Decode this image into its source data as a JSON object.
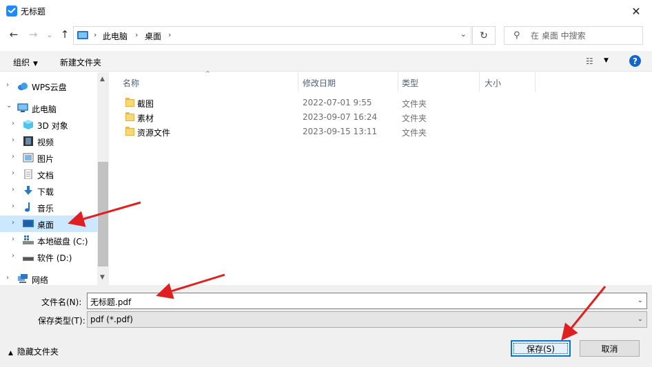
{
  "window": {
    "title": "无标题",
    "close_glyph": "✕"
  },
  "nav": {
    "back_glyph": "←",
    "forward_glyph": "→",
    "recent_glyph": "⌄",
    "up_glyph": "↑",
    "refresh_glyph": "↻",
    "breadcrumb": [
      "此电脑",
      "桌面"
    ],
    "breadcrumb_sep": "›",
    "dropdown_glyph": "⌄",
    "search_placeholder": "在 桌面 中搜索",
    "search_glyph": "⚲"
  },
  "toolbar": {
    "organize": "组织",
    "new_folder": "新建文件夹",
    "caret": "▼",
    "view_glyph": "☷",
    "help": "?"
  },
  "sidebar": {
    "items": [
      {
        "label": "WPS云盘",
        "icon": "cloud-icon"
      },
      {
        "label": "此电脑",
        "icon": "computer-icon",
        "expanded": true
      },
      {
        "label": "3D 对象",
        "icon": "cube-3d-icon"
      },
      {
        "label": "视频",
        "icon": "video-icon"
      },
      {
        "label": "图片",
        "icon": "picture-icon"
      },
      {
        "label": "文档",
        "icon": "document-icon"
      },
      {
        "label": "下载",
        "icon": "download-icon"
      },
      {
        "label": "音乐",
        "icon": "music-icon"
      },
      {
        "label": "桌面",
        "icon": "desktop-icon",
        "selected": true
      },
      {
        "label": "本地磁盘 (C:)",
        "icon": "drive-icon"
      },
      {
        "label": "软件 (D:)",
        "icon": "drive-icon"
      },
      {
        "label": "网络",
        "icon": "network-icon"
      }
    ],
    "chev_right": "›",
    "chev_down": "⌄",
    "scroll_up": "▲",
    "scroll_down": "▼"
  },
  "files": {
    "columns": {
      "name": "名称",
      "modified": "修改日期",
      "type": "类型",
      "size": "大小"
    },
    "sort_caret": "^",
    "rows": [
      {
        "name": "截图",
        "modified": "2022-07-01 9:55",
        "type": "文件夹"
      },
      {
        "name": "素材",
        "modified": "2023-09-07 16:24",
        "type": "文件夹"
      },
      {
        "name": "资源文件",
        "modified": "2023-09-15 13:11",
        "type": "文件夹"
      }
    ]
  },
  "form": {
    "filename_label": "文件名(N):",
    "filename_value": "无标题.pdf",
    "filetype_label": "保存类型(T):",
    "filetype_value": "pdf (*.pdf)",
    "drop_glyph": "⌄",
    "hide_folders": "隐藏文件夹",
    "hide_caret": "▲",
    "save_button": "保存(S)",
    "cancel_button": "取消"
  },
  "colors": {
    "accent": "#0078d7",
    "selection": "#cce8ff",
    "annotation_arrow": "#e02020"
  }
}
